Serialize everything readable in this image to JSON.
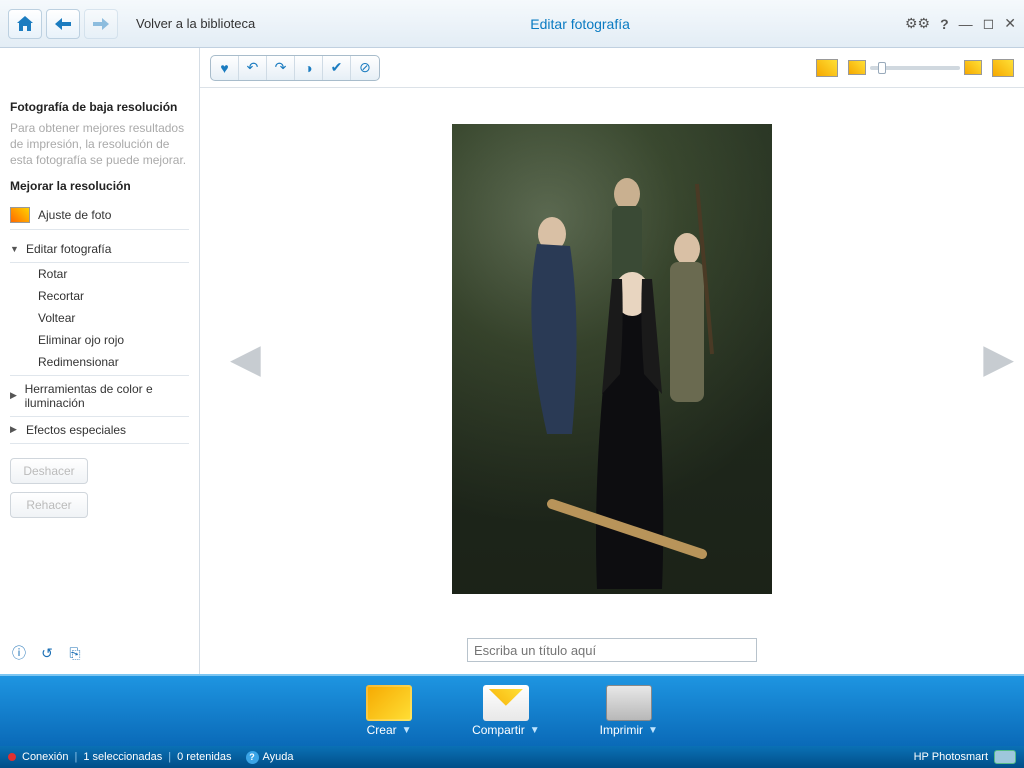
{
  "topbar": {
    "back_link": "Volver a la biblioteca",
    "title": "Editar fotografía"
  },
  "sidebar": {
    "low_res_title": "Fotografía de baja resolución",
    "low_res_desc": "Para obtener mejores resultados de impresión, la resolución de esta fotografía se puede mejorar.",
    "improve_title": "Mejorar la resolución",
    "adjust_label": "Ajuste de foto",
    "edit_section": "Editar fotografía",
    "items": [
      "Rotar",
      "Recortar",
      "Voltear",
      "Eliminar ojo rojo",
      "Redimensionar"
    ],
    "color_section": "Herramientas de color e iluminación",
    "effects_section": "Efectos especiales",
    "undo_label": "Deshacer",
    "redo_label": "Rehacer"
  },
  "content": {
    "title_placeholder": "Escriba un título aquí"
  },
  "actions": {
    "create": "Crear",
    "share": "Compartir",
    "print": "Imprimir"
  },
  "status": {
    "connection": "Conexión",
    "selected": "1 seleccionadas",
    "retained": "0 retenidas",
    "help": "Ayuda",
    "brand": "HP Photosmart"
  }
}
